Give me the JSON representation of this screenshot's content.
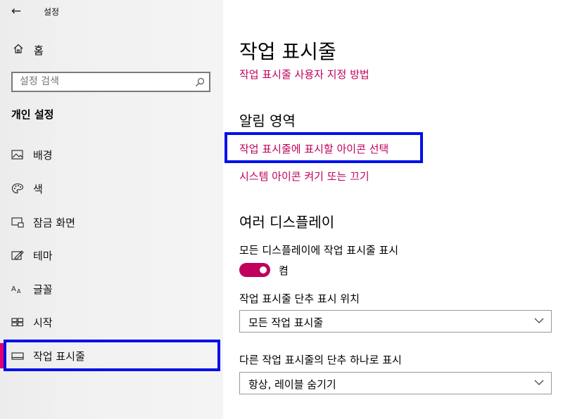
{
  "window": {
    "title": "설정",
    "back_icon": "←"
  },
  "sidebar": {
    "home_label": "홈",
    "search_placeholder": "설정 검색",
    "section_title": "개인 설정",
    "items": [
      {
        "label": "배경",
        "icon": "image-icon"
      },
      {
        "label": "색",
        "icon": "palette-icon"
      },
      {
        "label": "잠금 화면",
        "icon": "lock-screen-icon"
      },
      {
        "label": "테마",
        "icon": "theme-icon"
      },
      {
        "label": "글꼴",
        "icon": "font-icon"
      },
      {
        "label": "시작",
        "icon": "start-icon"
      },
      {
        "label": "작업 표시줄",
        "icon": "taskbar-icon",
        "active": true
      }
    ],
    "active_color": "#e3006b"
  },
  "main": {
    "title": "작업 표시줄",
    "customize_link": "작업 표시줄 사용자 지정 방법",
    "notification_area": {
      "heading": "알림 영역",
      "select_icons_link": "작업 표시줄에 표시할 아이콘 선택",
      "system_icons_link": "시스템 아이콘 켜기 또는 끄기"
    },
    "multiple_displays": {
      "heading": "여러 디스플레이",
      "show_all_label": "모든 디스플레이에 작업 표시줄 표시",
      "toggle_state": "켬",
      "buttons_location_label": "작업 표시줄 단추 표시 위치",
      "buttons_location_value": "모든 작업 표시줄",
      "combine_label": "다른 작업 표시줄의 단추 하나로 표시",
      "combine_value": "항상, 레이블 숨기기"
    },
    "accent_color": "#c0005c",
    "highlight_color": "#0010e8"
  }
}
